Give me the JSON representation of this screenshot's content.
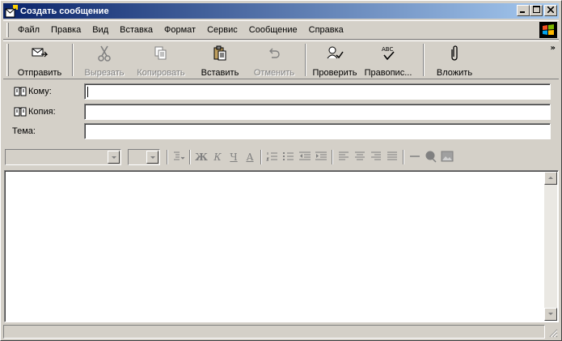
{
  "window": {
    "title": "Создать сообщение",
    "title_gradient_start": "#0a246a",
    "title_gradient_end": "#a6caf0",
    "face_color": "#d4d0c8",
    "buttons": {
      "minimize": "_",
      "maximize": "□",
      "close": "×"
    }
  },
  "menu": {
    "items": [
      "Файл",
      "Правка",
      "Вид",
      "Вставка",
      "Формат",
      "Сервис",
      "Сообщение",
      "Справка"
    ],
    "logo_icon": "windows-logo-icon"
  },
  "toolbar": {
    "items": [
      {
        "label": "Отправить",
        "icon": "send-icon",
        "enabled": true
      },
      {
        "label": "Вырезать",
        "icon": "scissors-icon",
        "enabled": false
      },
      {
        "label": "Копировать",
        "icon": "copy-icon",
        "enabled": false
      },
      {
        "label": "Вставить",
        "icon": "paste-icon",
        "enabled": true
      },
      {
        "label": "Отменить",
        "icon": "undo-icon",
        "enabled": false
      },
      {
        "label": "Проверить",
        "icon": "check-names-icon",
        "enabled": true
      },
      {
        "label": "Правопис...",
        "icon": "spelling-icon",
        "enabled": true
      },
      {
        "label": "Вложить",
        "icon": "paperclip-icon",
        "enabled": true
      }
    ],
    "more_glyph": "»"
  },
  "fields": {
    "to_label": "Кому:",
    "to_value": "",
    "cc_label": "Копия:",
    "cc_value": "",
    "subject_label": "Тема:",
    "subject_value": ""
  },
  "format_toolbar": {
    "font_value": "",
    "size_value": "",
    "bold_glyph": "Ж",
    "italic_glyph": "К",
    "underline_glyph": "Ч",
    "font_color_glyph": "А"
  },
  "body": {
    "text": ""
  }
}
